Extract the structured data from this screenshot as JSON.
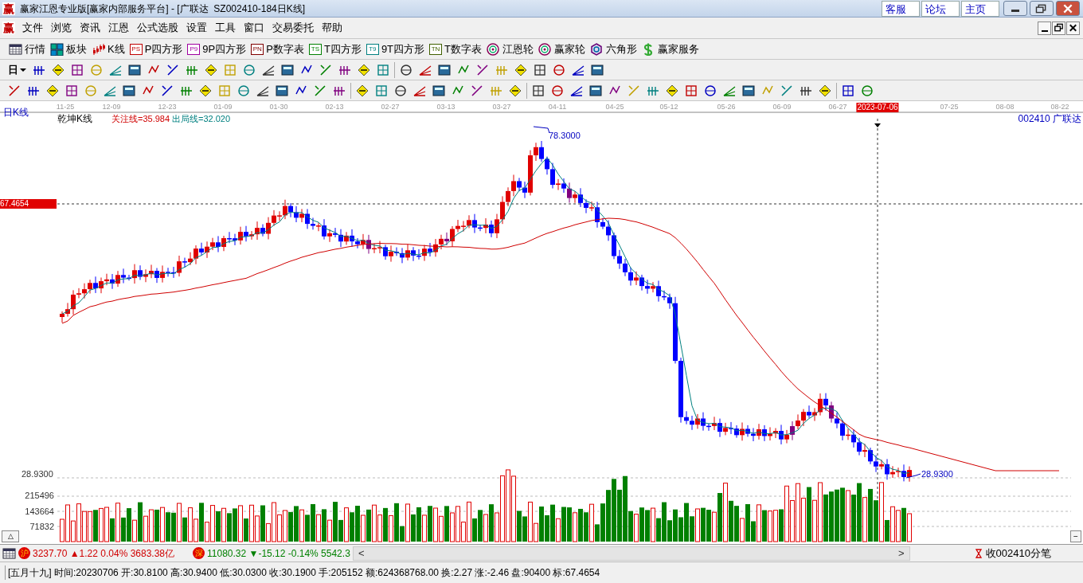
{
  "logo": [
    "赢",
    "赢"
  ],
  "window": {
    "title": "赢家江恩专业版[赢家内部服务平台] - [广联达  SZ002410-184日K线]",
    "links": [
      "客服",
      "论坛",
      "主页"
    ]
  },
  "menu": [
    "文件",
    "浏览",
    "资讯",
    "江恩",
    "公式选股",
    "设置",
    "工具",
    "窗口",
    "交易委托",
    "帮助"
  ],
  "toolbar": [
    {
      "label": "行情",
      "kind": "table"
    },
    {
      "label": "板块",
      "kind": "blocks"
    },
    {
      "label": "K线",
      "kind": "candles"
    },
    {
      "label": "P四方形",
      "kind": "badge",
      "badge": "PS",
      "color": "#c00000"
    },
    {
      "label": "9P四方形",
      "kind": "badge",
      "badge": "P9",
      "color": "#a000a0"
    },
    {
      "label": "P数字表",
      "kind": "badge",
      "badge": "PN",
      "color": "#800000"
    },
    {
      "label": "T四方形",
      "kind": "badge",
      "badge": "TS",
      "color": "#008000"
    },
    {
      "label": "9T四方形",
      "kind": "badge",
      "badge": "T9",
      "color": "#008080"
    },
    {
      "label": "T数字表",
      "kind": "badge",
      "badge": "TN",
      "color": "#406000"
    },
    {
      "label": "江恩轮",
      "kind": "wheel"
    },
    {
      "label": "赢家轮",
      "kind": "wheel"
    },
    {
      "label": "六角形",
      "kind": "hexagon"
    },
    {
      "label": "赢家服务",
      "kind": "dollar"
    }
  ],
  "period_dropdown": "日",
  "chart": {
    "period": "日K线",
    "indicator": "乾坤K线",
    "lines": [
      {
        "label": "关注线=35.984",
        "color": "#d00000"
      },
      {
        "label": "出局线=32.020",
        "color": "#008080"
      }
    ],
    "stock": "002410 广联达",
    "dates": [
      {
        "label": "11-25",
        "selected": false
      },
      {
        "label": "12-09",
        "selected": false
      },
      {
        "label": "12-23",
        "selected": false
      },
      {
        "label": "01-09",
        "selected": false
      },
      {
        "label": "01-30",
        "selected": false
      },
      {
        "label": "02-13",
        "selected": false
      },
      {
        "label": "02-27",
        "selected": false
      },
      {
        "label": "03-13",
        "selected": false
      },
      {
        "label": "03-27",
        "selected": false
      },
      {
        "label": "04-11",
        "selected": false
      },
      {
        "label": "04-25",
        "selected": false
      },
      {
        "label": "05-12",
        "selected": false
      },
      {
        "label": "05-26",
        "selected": false
      },
      {
        "label": "06-09",
        "selected": false
      },
      {
        "label": "06-27",
        "selected": false
      },
      {
        "label": "2023-07-06",
        "selected": true
      },
      {
        "label": "07-25",
        "selected": false
      },
      {
        "label": "08-08",
        "selected": false
      },
      {
        "label": "08-22",
        "selected": false
      }
    ],
    "crosshair_price": "67.4654",
    "high_label": "78.3000",
    "low_label": "28.9300",
    "axis_low": "28.9300",
    "volume_ticks": [
      "215496",
      "143664",
      "71832"
    ],
    "expand_button": "△",
    "collapse_button": "−"
  },
  "indices": [
    {
      "badge": "沪",
      "text": "3237.70 ▲1.22 0.04% 3683.38亿",
      "color": "#d00000"
    },
    {
      "badge": "深",
      "text": "11080.32 ▼-15.12 -0.14% 5542.3",
      "color": "#008000"
    }
  ],
  "scroll": {
    "left": "<",
    "right": ">"
  },
  "tick_button": "收002410分笔",
  "info": "[五月十九] 时间:20230706 开:30.8100 高:30.9400 低:30.0300 收:30.1900 手:205152 额:624368768.00 换:2.27 涨:-2.46 盘:90400 标:67.4654"
}
